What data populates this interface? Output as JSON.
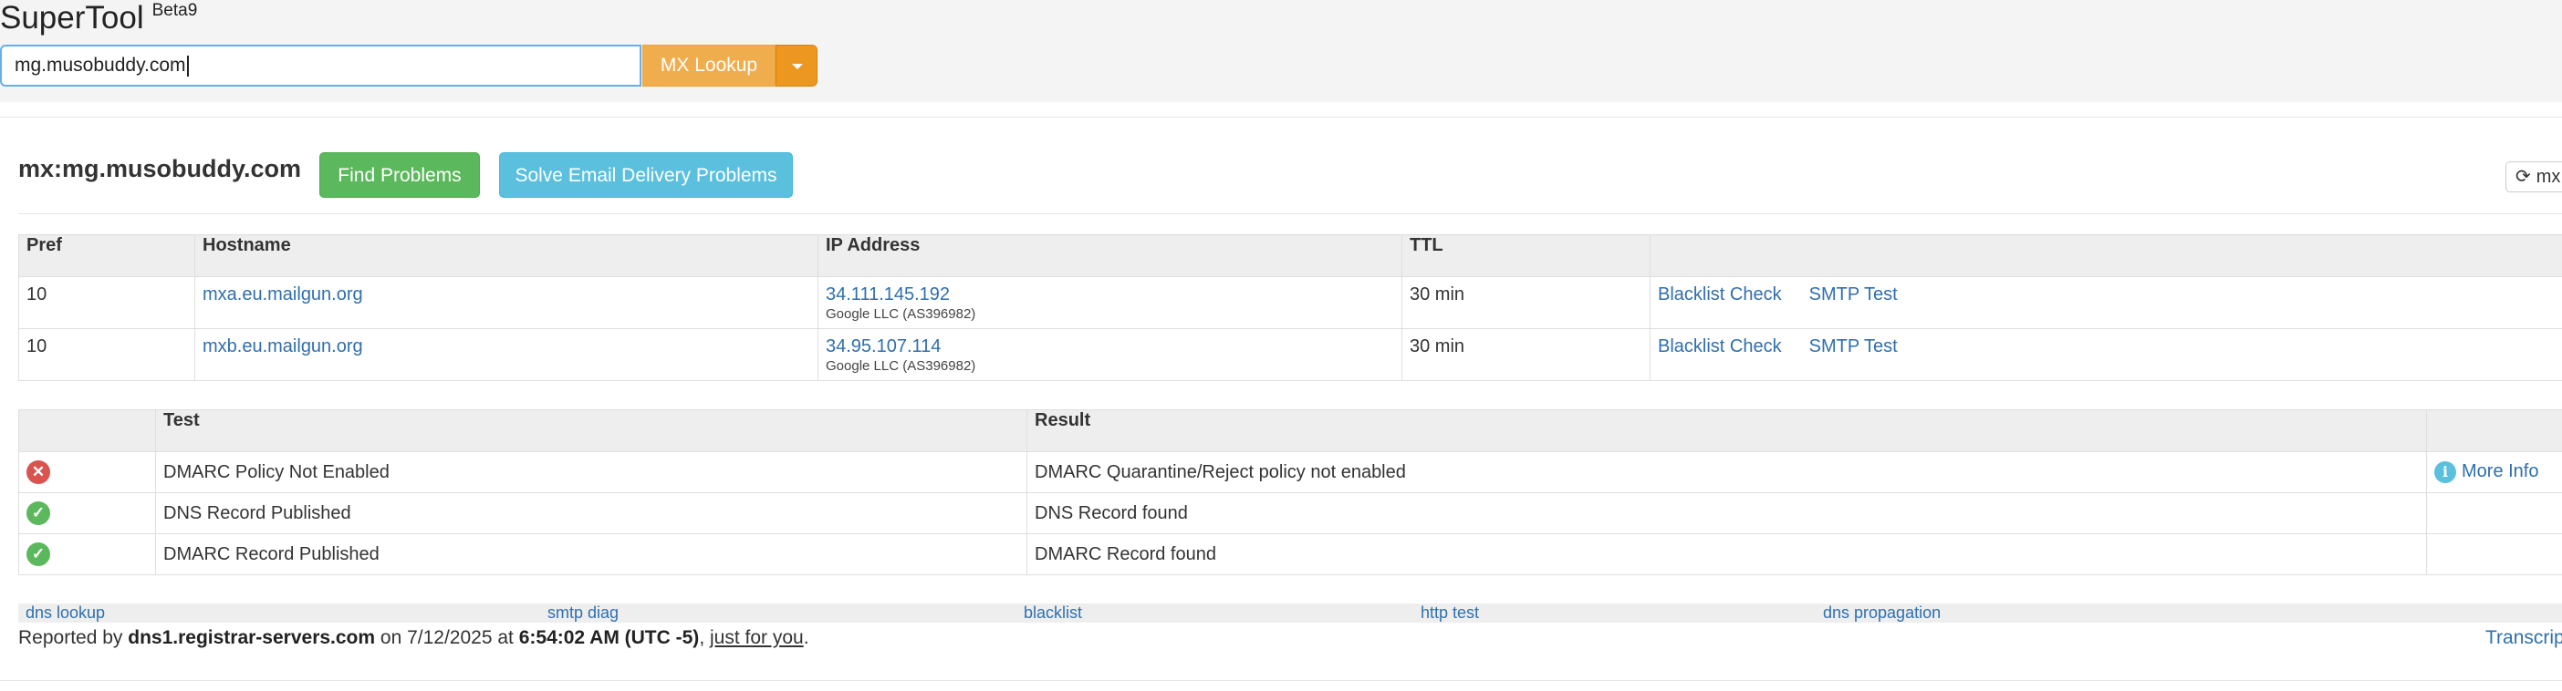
{
  "app": {
    "title": "SuperTool",
    "badge": "Beta9"
  },
  "search": {
    "value": "mg.musobuddy.com",
    "button_label": "MX Lookup"
  },
  "result": {
    "title": "mx:mg.musobuddy.com",
    "find_problems_label": "Find Problems",
    "solve_label": "Solve Email Delivery Problems",
    "refresh_label": "mx"
  },
  "mx_table": {
    "headers": [
      "Pref",
      "Hostname",
      "IP Address",
      "TTL"
    ],
    "rows": [
      {
        "pref": "10",
        "hostname": "mxa.eu.mailgun.org",
        "ip": "34.111.145.192",
        "asn": "Google LLC (AS396982)",
        "ttl": "30 min",
        "blacklist": "Blacklist Check",
        "smtp": "SMTP Test"
      },
      {
        "pref": "10",
        "hostname": "mxb.eu.mailgun.org",
        "ip": "34.95.107.114",
        "asn": "Google LLC (AS396982)",
        "ttl": "30 min",
        "blacklist": "Blacklist Check",
        "smtp": "SMTP Test"
      }
    ]
  },
  "test_table": {
    "headers": [
      "Test",
      "Result"
    ],
    "rows": [
      {
        "status": "fail",
        "test": "DMARC Policy Not Enabled",
        "result": "DMARC Quarantine/Reject policy not enabled",
        "more_info": "More Info"
      },
      {
        "status": "pass",
        "test": "DNS Record Published",
        "result": "DNS Record found",
        "more_info": ""
      },
      {
        "status": "pass",
        "test": "DMARC Record Published",
        "result": "DMARC Record found",
        "more_info": ""
      }
    ]
  },
  "footer_links": [
    "dns lookup",
    "smtp diag",
    "blacklist",
    "http test",
    "dns propagation"
  ],
  "report": {
    "prefix": "Reported by",
    "server": "dns1.registrar-servers.com",
    "on": "on 7/12/2025 at",
    "time": "6:54:02 AM (UTC -5)",
    "comma": ",",
    "just_for_you": "just for you",
    "period": ".",
    "transcript": "Transcript"
  },
  "colors": {
    "accent_link": "#2f6fad",
    "mx_button": "#f0ad4e",
    "find_button": "#5cb85c",
    "solve_button": "#5bc0de",
    "fail": "#d9534f",
    "pass": "#5cb85c"
  }
}
